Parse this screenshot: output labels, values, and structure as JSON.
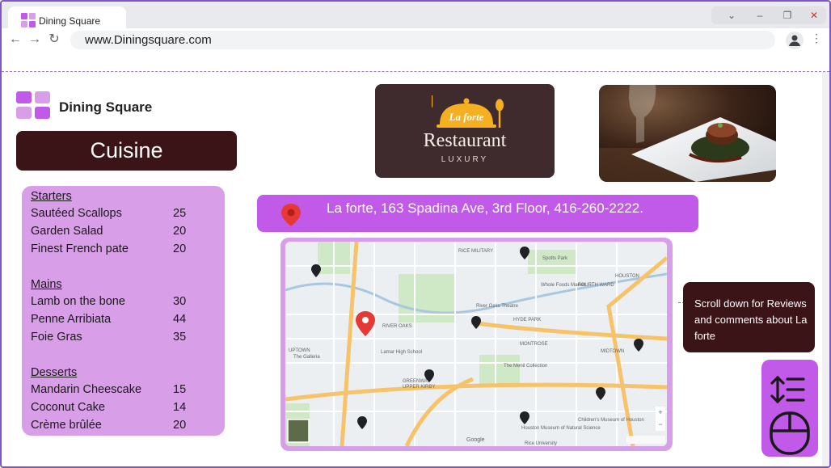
{
  "browser": {
    "tab_title": "Dining Square",
    "url": "www.Diningsquare.com",
    "controls": {
      "dropdown": "⌄",
      "minimize": "–",
      "restore": "❐",
      "close": "✕"
    },
    "nav": {
      "back": "←",
      "forward": "→",
      "reload": "↻"
    }
  },
  "brand": {
    "name": "Dining Square",
    "mark_colors": [
      "#c15ae8",
      "#d89ee8"
    ]
  },
  "cuisine": {
    "title": "Cuisine"
  },
  "menu": {
    "sections": [
      {
        "title": "Starters",
        "items": [
          {
            "name": "Sautéed Scallops",
            "price": "25"
          },
          {
            "name": "Garden Salad",
            "price": "20"
          },
          {
            "name": "Finest French pate",
            "price": "20"
          }
        ]
      },
      {
        "title": "Mains",
        "items": [
          {
            "name": "Lamb on the bone",
            "price": "30"
          },
          {
            "name": "Penne Arribiata",
            "price": "44"
          },
          {
            "name": "Foie Gras",
            "price": "35"
          }
        ]
      },
      {
        "title": "Desserts",
        "items": [
          {
            "name": "Mandarin Cheescake",
            "price": "15"
          },
          {
            "name": "Coconut Cake",
            "price": "14"
          },
          {
            "name": "Crème brûlée",
            "price": "20"
          }
        ]
      }
    ]
  },
  "restaurant_logo": {
    "script": "La forte",
    "name": "Restaurant",
    "tagline": "LUXURY"
  },
  "address": {
    "text": "La forte, 163 Spadina Ave, 3rd Floor, 416-260-2222."
  },
  "map": {
    "labels": [
      "RICE MILITARY",
      "Spotts Park",
      "HYDE PARK",
      "RIVER OAKS",
      "MONTROSE",
      "MIDTOWN",
      "UPTOWN",
      "GREENWAY",
      "UPPER KIRBY",
      "The Galleria",
      "River Oaks Theatre",
      "Whole Foods Market",
      "Lamar High School",
      "The Menil Collection",
      "Houston Museum of Natural Science",
      "Children's Museum of Houston",
      "Rice University",
      "HOUSTON",
      "FOURTH WARD",
      "Google"
    ],
    "zoom_in": "+",
    "zoom_out": "−"
  },
  "tooltip": {
    "text": "Scroll down for Reviews and comments about La forte"
  },
  "icons": {
    "sort": "sort-lines-icon",
    "mouse": "mouse-icon",
    "pin": "map-pin-icon"
  },
  "colors": {
    "accent": "#c15ae8",
    "menu_bg": "#d89ee8",
    "dark": "#3a1416",
    "pin_red": "#e53935"
  }
}
